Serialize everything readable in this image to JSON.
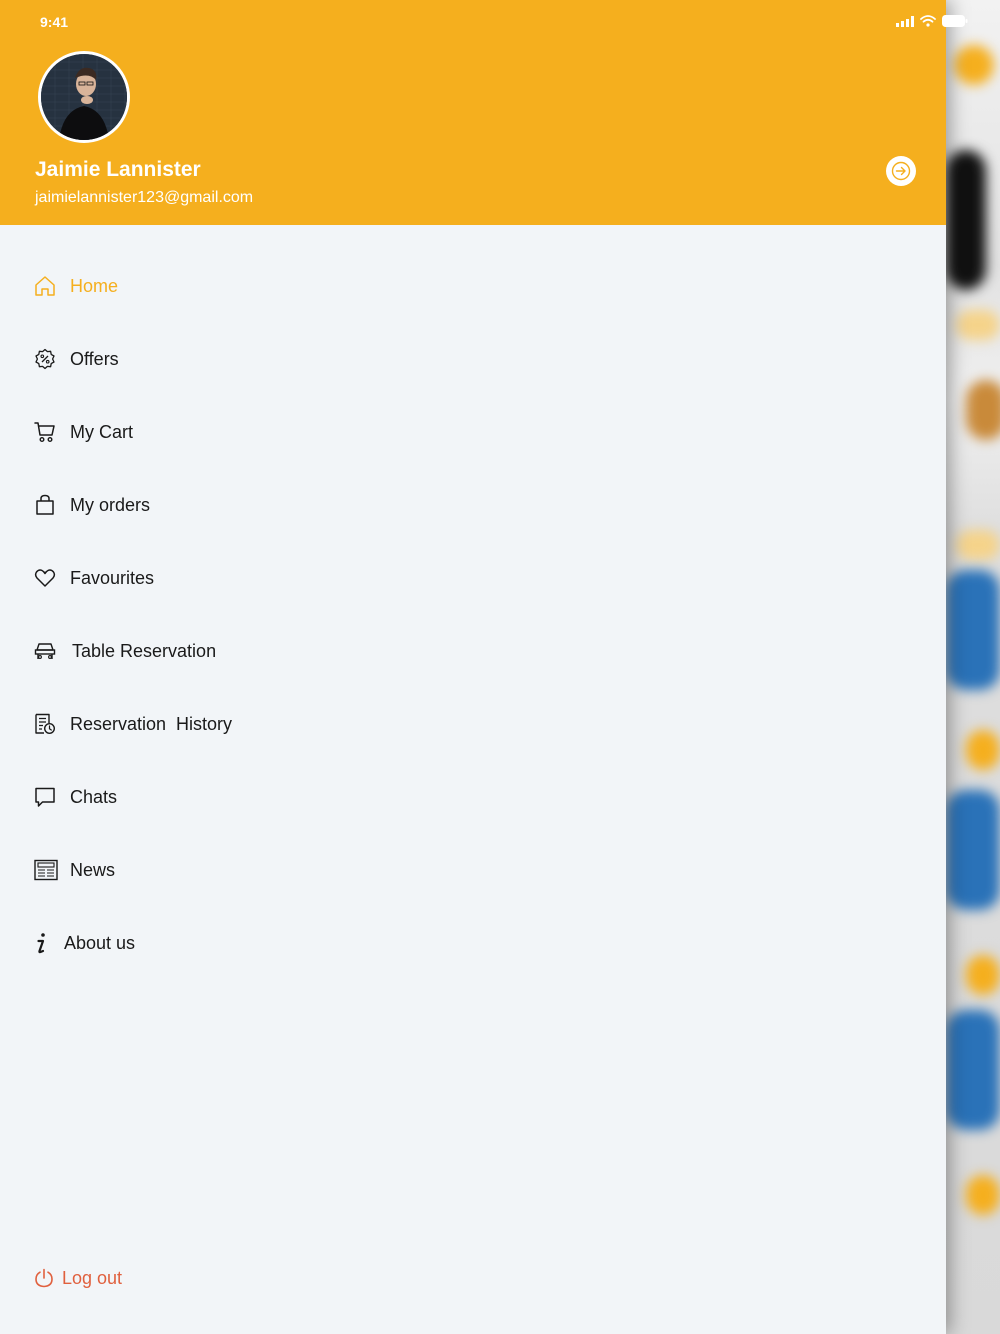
{
  "status_bar": {
    "time": "9:41"
  },
  "profile": {
    "name": "Jaimie Lannister",
    "email": "jaimielannister123@gmail.com"
  },
  "menu": {
    "items": [
      {
        "label": "Home",
        "icon": "home-icon",
        "active": true
      },
      {
        "label": "Offers",
        "icon": "offer-badge-icon",
        "active": false
      },
      {
        "label": "My Cart",
        "icon": "cart-icon",
        "active": false
      },
      {
        "label": "My orders",
        "icon": "shopping-bag-icon",
        "active": false
      },
      {
        "label": "Favourites",
        "icon": "heart-icon",
        "active": false
      },
      {
        "label": "Table Reservation",
        "icon": "table-icon",
        "active": false
      },
      {
        "label": "Reservation  History",
        "icon": "reservation-history-icon",
        "active": false
      },
      {
        "label": "Chats",
        "icon": "chat-icon",
        "active": false
      },
      {
        "label": "News",
        "icon": "newspaper-icon",
        "active": false
      },
      {
        "label": "About us",
        "icon": "info-icon",
        "active": false
      }
    ]
  },
  "logout": {
    "label": "Log out"
  },
  "colors": {
    "accent": "#f5af1e",
    "drawer_bg": "#f2f5f8",
    "logout": "#e0603e",
    "text": "#1a1a1a"
  }
}
